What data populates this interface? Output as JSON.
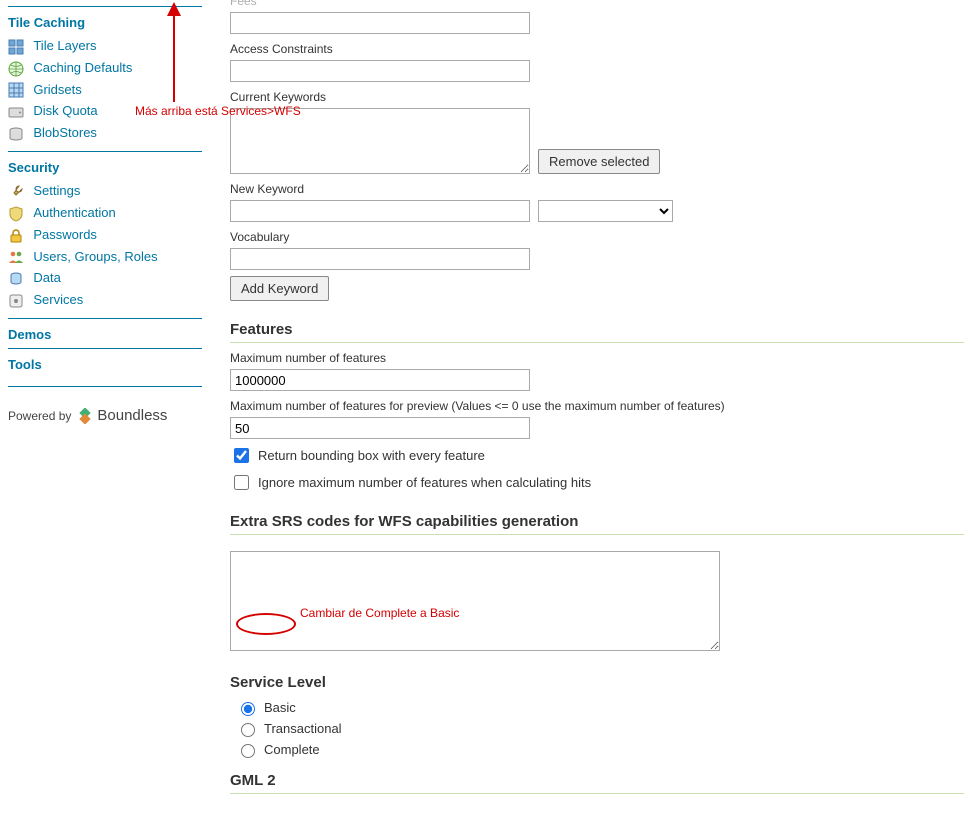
{
  "sidebar": {
    "groups": [
      {
        "title": "Tile Caching",
        "items": [
          {
            "label": "Tile Layers",
            "icon": "grid-icon"
          },
          {
            "label": "Caching Defaults",
            "icon": "globe-icon"
          },
          {
            "label": "Gridsets",
            "icon": "gridset-icon"
          },
          {
            "label": "Disk Quota",
            "icon": "disk-icon"
          },
          {
            "label": "BlobStores",
            "icon": "blob-icon"
          }
        ]
      },
      {
        "title": "Security",
        "items": [
          {
            "label": "Settings",
            "icon": "wrench-icon"
          },
          {
            "label": "Authentication",
            "icon": "shield-icon"
          },
          {
            "label": "Passwords",
            "icon": "lock-icon"
          },
          {
            "label": "Users, Groups, Roles",
            "icon": "users-icon"
          },
          {
            "label": "Data",
            "icon": "data-icon"
          },
          {
            "label": "Services",
            "icon": "services-icon"
          }
        ]
      },
      {
        "title": "Demos",
        "items": []
      },
      {
        "title": "Tools",
        "items": []
      }
    ],
    "powered_by": "Powered by",
    "brand": "Boundless"
  },
  "main": {
    "fees_label": "Fees",
    "access_constraints_label": "Access Constraints",
    "current_keywords_label": "Current Keywords",
    "remove_selected_label": "Remove selected",
    "new_keyword_label": "New Keyword",
    "vocabulary_label": "Vocabulary",
    "add_keyword_label": "Add Keyword",
    "features_heading": "Features",
    "max_features_label": "Maximum number of features",
    "max_features_value": "1000000",
    "max_features_preview_label": "Maximum number of features for preview (Values <= 0 use the maximum number of features)",
    "max_features_preview_value": "50",
    "return_bbox_label": "Return bounding box with every feature",
    "return_bbox_checked": true,
    "ignore_max_label": "Ignore maximum number of features when calculating hits",
    "ignore_max_checked": false,
    "extra_srs_heading": "Extra SRS codes for WFS capabilities generation",
    "service_level_heading": "Service Level",
    "service_levels": [
      {
        "label": "Basic",
        "value": "basic",
        "checked": true
      },
      {
        "label": "Transactional",
        "value": "transactional",
        "checked": false
      },
      {
        "label": "Complete",
        "value": "complete",
        "checked": false
      }
    ],
    "gml2_heading": "GML 2"
  },
  "annotations": {
    "top_note": "Más arriba está Services>WFS",
    "circle_note": "Cambiar de Complete a Basic"
  }
}
